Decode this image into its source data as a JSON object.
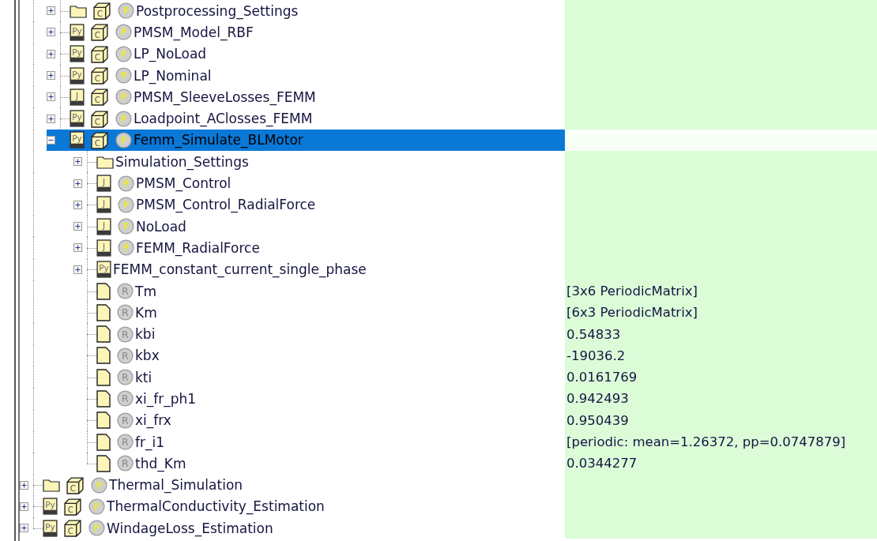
{
  "tree": {
    "continued_children": [
      {
        "label": "Postprocessing_Settings",
        "kind": "folder",
        "expanded": false,
        "selected": false,
        "class_letter": "C",
        "badge": {
          "letter": "P",
          "kind": "parameter"
        }
      },
      {
        "label": "PMSM_Model_RBF",
        "kind": "script",
        "script_letter": "Py",
        "expanded": false,
        "selected": false,
        "class_letter": "C",
        "badge": {
          "letter": "P",
          "kind": "parameter"
        }
      },
      {
        "label": "LP_NoLoad",
        "kind": "script",
        "script_letter": "Py",
        "expanded": false,
        "selected": false,
        "class_letter": "C",
        "badge": {
          "letter": "P",
          "kind": "parameter"
        }
      },
      {
        "label": "LP_Nominal",
        "kind": "script",
        "script_letter": "Py",
        "expanded": false,
        "selected": false,
        "class_letter": "C",
        "badge": {
          "letter": "P",
          "kind": "parameter"
        }
      },
      {
        "label": "PMSM_SleeveLosses_FEMM",
        "kind": "script",
        "script_letter": "J",
        "expanded": false,
        "selected": false,
        "class_letter": "C",
        "badge": {
          "letter": "P",
          "kind": "parameter"
        }
      },
      {
        "label": "Loadpoint_AClosses_FEMM",
        "kind": "script",
        "script_letter": "Py",
        "expanded": false,
        "selected": false,
        "class_letter": "C",
        "badge": {
          "letter": "P",
          "kind": "parameter"
        }
      },
      {
        "label": "Femm_Simulate_BLMotor",
        "kind": "script",
        "script_letter": "Py",
        "expanded": true,
        "selected": true,
        "class_letter": "C",
        "badge": {
          "letter": "P",
          "kind": "parameter"
        },
        "children": [
          {
            "label": "Simulation_Settings",
            "kind": "folder",
            "expanded": false,
            "selected": false
          },
          {
            "label": "PMSM_Control",
            "kind": "script",
            "script_letter": "J",
            "expanded": false,
            "selected": false,
            "badge": {
              "letter": "P",
              "kind": "parameter"
            }
          },
          {
            "label": "PMSM_Control_RadialForce",
            "kind": "script",
            "script_letter": "J",
            "expanded": false,
            "selected": false,
            "badge": {
              "letter": "P",
              "kind": "parameter"
            }
          },
          {
            "label": "NoLoad",
            "kind": "script",
            "script_letter": "J",
            "expanded": false,
            "selected": false,
            "badge": {
              "letter": "P",
              "kind": "parameter"
            }
          },
          {
            "label": "FEMM_RadialForce",
            "kind": "script",
            "script_letter": "J",
            "expanded": false,
            "selected": false,
            "badge": {
              "letter": "P",
              "kind": "parameter"
            }
          },
          {
            "label": "FEMM_constant_current_single_phase",
            "kind": "script",
            "script_letter": "Py",
            "expanded": false,
            "selected": false
          },
          {
            "label": "Tm",
            "kind": "file",
            "selected": false,
            "badge": {
              "letter": "R",
              "kind": "result"
            },
            "value": "[3x6 PeriodicMatrix]"
          },
          {
            "label": "Km",
            "kind": "file",
            "selected": false,
            "badge": {
              "letter": "R",
              "kind": "result"
            },
            "value": "[6x3 PeriodicMatrix]"
          },
          {
            "label": "kbi",
            "kind": "file",
            "selected": false,
            "badge": {
              "letter": "R",
              "kind": "result"
            },
            "value": "0.54833"
          },
          {
            "label": "kbx",
            "kind": "file",
            "selected": false,
            "badge": {
              "letter": "R",
              "kind": "result"
            },
            "value": "-19036.2"
          },
          {
            "label": "kti",
            "kind": "file",
            "selected": false,
            "badge": {
              "letter": "R",
              "kind": "result"
            },
            "value": "0.0161769"
          },
          {
            "label": "xi_fr_ph1",
            "kind": "file",
            "selected": false,
            "badge": {
              "letter": "R",
              "kind": "result"
            },
            "value": "0.942493"
          },
          {
            "label": "xi_frx",
            "kind": "file",
            "selected": false,
            "badge": {
              "letter": "R",
              "kind": "result"
            },
            "value": "0.950439"
          },
          {
            "label": "fr_i1",
            "kind": "file",
            "selected": false,
            "badge": {
              "letter": "R",
              "kind": "result"
            },
            "value": "[periodic: mean=1.26372, pp=0.0747879]"
          },
          {
            "label": "thd_Km",
            "kind": "file",
            "selected": false,
            "badge": {
              "letter": "R",
              "kind": "result"
            },
            "value": "0.0344277"
          }
        ]
      }
    ],
    "nodes": [
      {
        "label": "Thermal_Simulation",
        "kind": "folder",
        "expanded": false,
        "selected": false,
        "class_letter": "C",
        "badge": {
          "letter": "P",
          "kind": "parameter"
        }
      },
      {
        "label": "ThermalConductivity_Estimation",
        "kind": "script",
        "script_letter": "Py",
        "expanded": false,
        "selected": false,
        "class_letter": "C",
        "badge": {
          "letter": "P",
          "kind": "parameter"
        }
      },
      {
        "label": "WindageLoss_Estimation",
        "kind": "script",
        "script_letter": "Py",
        "expanded": false,
        "selected": false,
        "class_letter": "C",
        "badge": {
          "letter": "P",
          "kind": "parameter"
        }
      }
    ]
  }
}
